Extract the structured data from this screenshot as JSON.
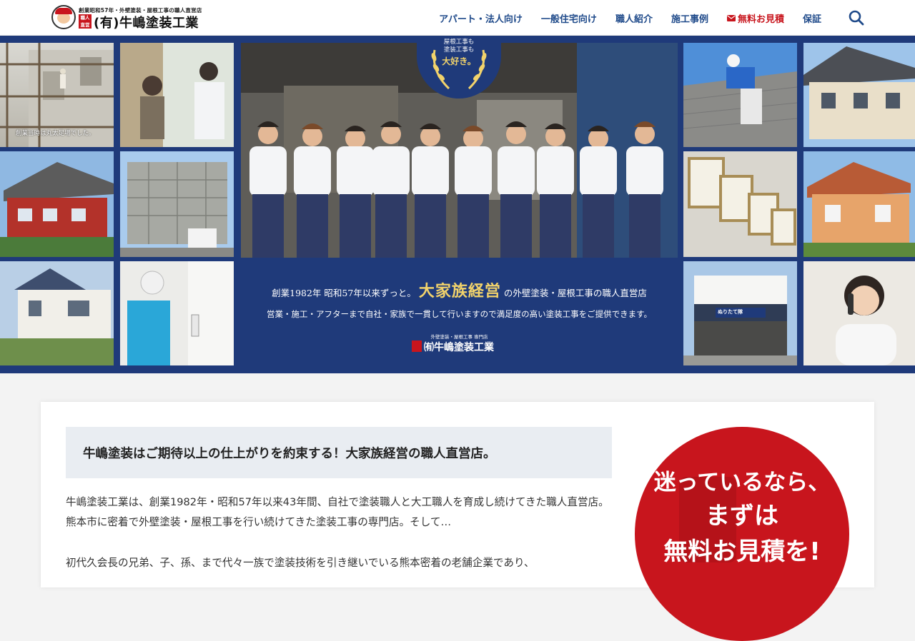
{
  "header": {
    "logo": {
      "tagline": "創業昭和57年・外壁塗装・屋根工事の職人直営店",
      "badge": "職人直営",
      "name": "(有)牛嶋塗装工業"
    },
    "nav": [
      {
        "label": "アパート・法人向け"
      },
      {
        "label": "一般住宅向け"
      },
      {
        "label": "職人紹介"
      },
      {
        "label": "施工事例"
      },
      {
        "label": "無料お見積",
        "icon": "mail-icon"
      },
      {
        "label": "保証"
      }
    ],
    "search_icon": "search-icon"
  },
  "hero": {
    "caption_old_scaffold": "創業当時は丸太足場でした。",
    "medal": {
      "line1": "屋根工事も",
      "line2": "塗装工事も",
      "big": "大好き。"
    },
    "line1_before": "創業1982年 昭和57年以来ずっと。",
    "line1_em": "大家族経営",
    "line1_after": "の外壁塗装・屋根工事の職人直営店",
    "line2": "営業・施工・アフターまで自社・家族で一貫して行いますので満足度の高い塗装工事をご提供できます。",
    "small": "外壁塗装・屋根工事 専門店",
    "logo_name": "㈲牛嶋塗装工業",
    "shop_sign": "ぬりたて隊"
  },
  "main": {
    "headline": "牛嶋塗装はご期待以上の仕上がりを約束する！大家族経営の職人直営店。",
    "paragraph1": "牛嶋塗装工業は、創業1982年・昭和57年以来43年間、自社で塗装職人と大工職人を育成し続けてきた職人直営店。熊本市に密着で外壁塗装・屋根工事を行い続けてきた塗装工事の専門店。そして…",
    "paragraph2": "初代久会長の兄弟、子、孫、まで代々一族で塗装技術を引き継いでいる熊本密着の老舗企業であり、",
    "cta": {
      "line1": "迷っているなら、",
      "line2": "まずは",
      "line3": "無料お見積を!"
    }
  },
  "colors": {
    "nav": "#1f4a8a",
    "accent_red": "#c8151d",
    "hero_bg": "#1f3a7a",
    "gold": "#f2d36b"
  }
}
